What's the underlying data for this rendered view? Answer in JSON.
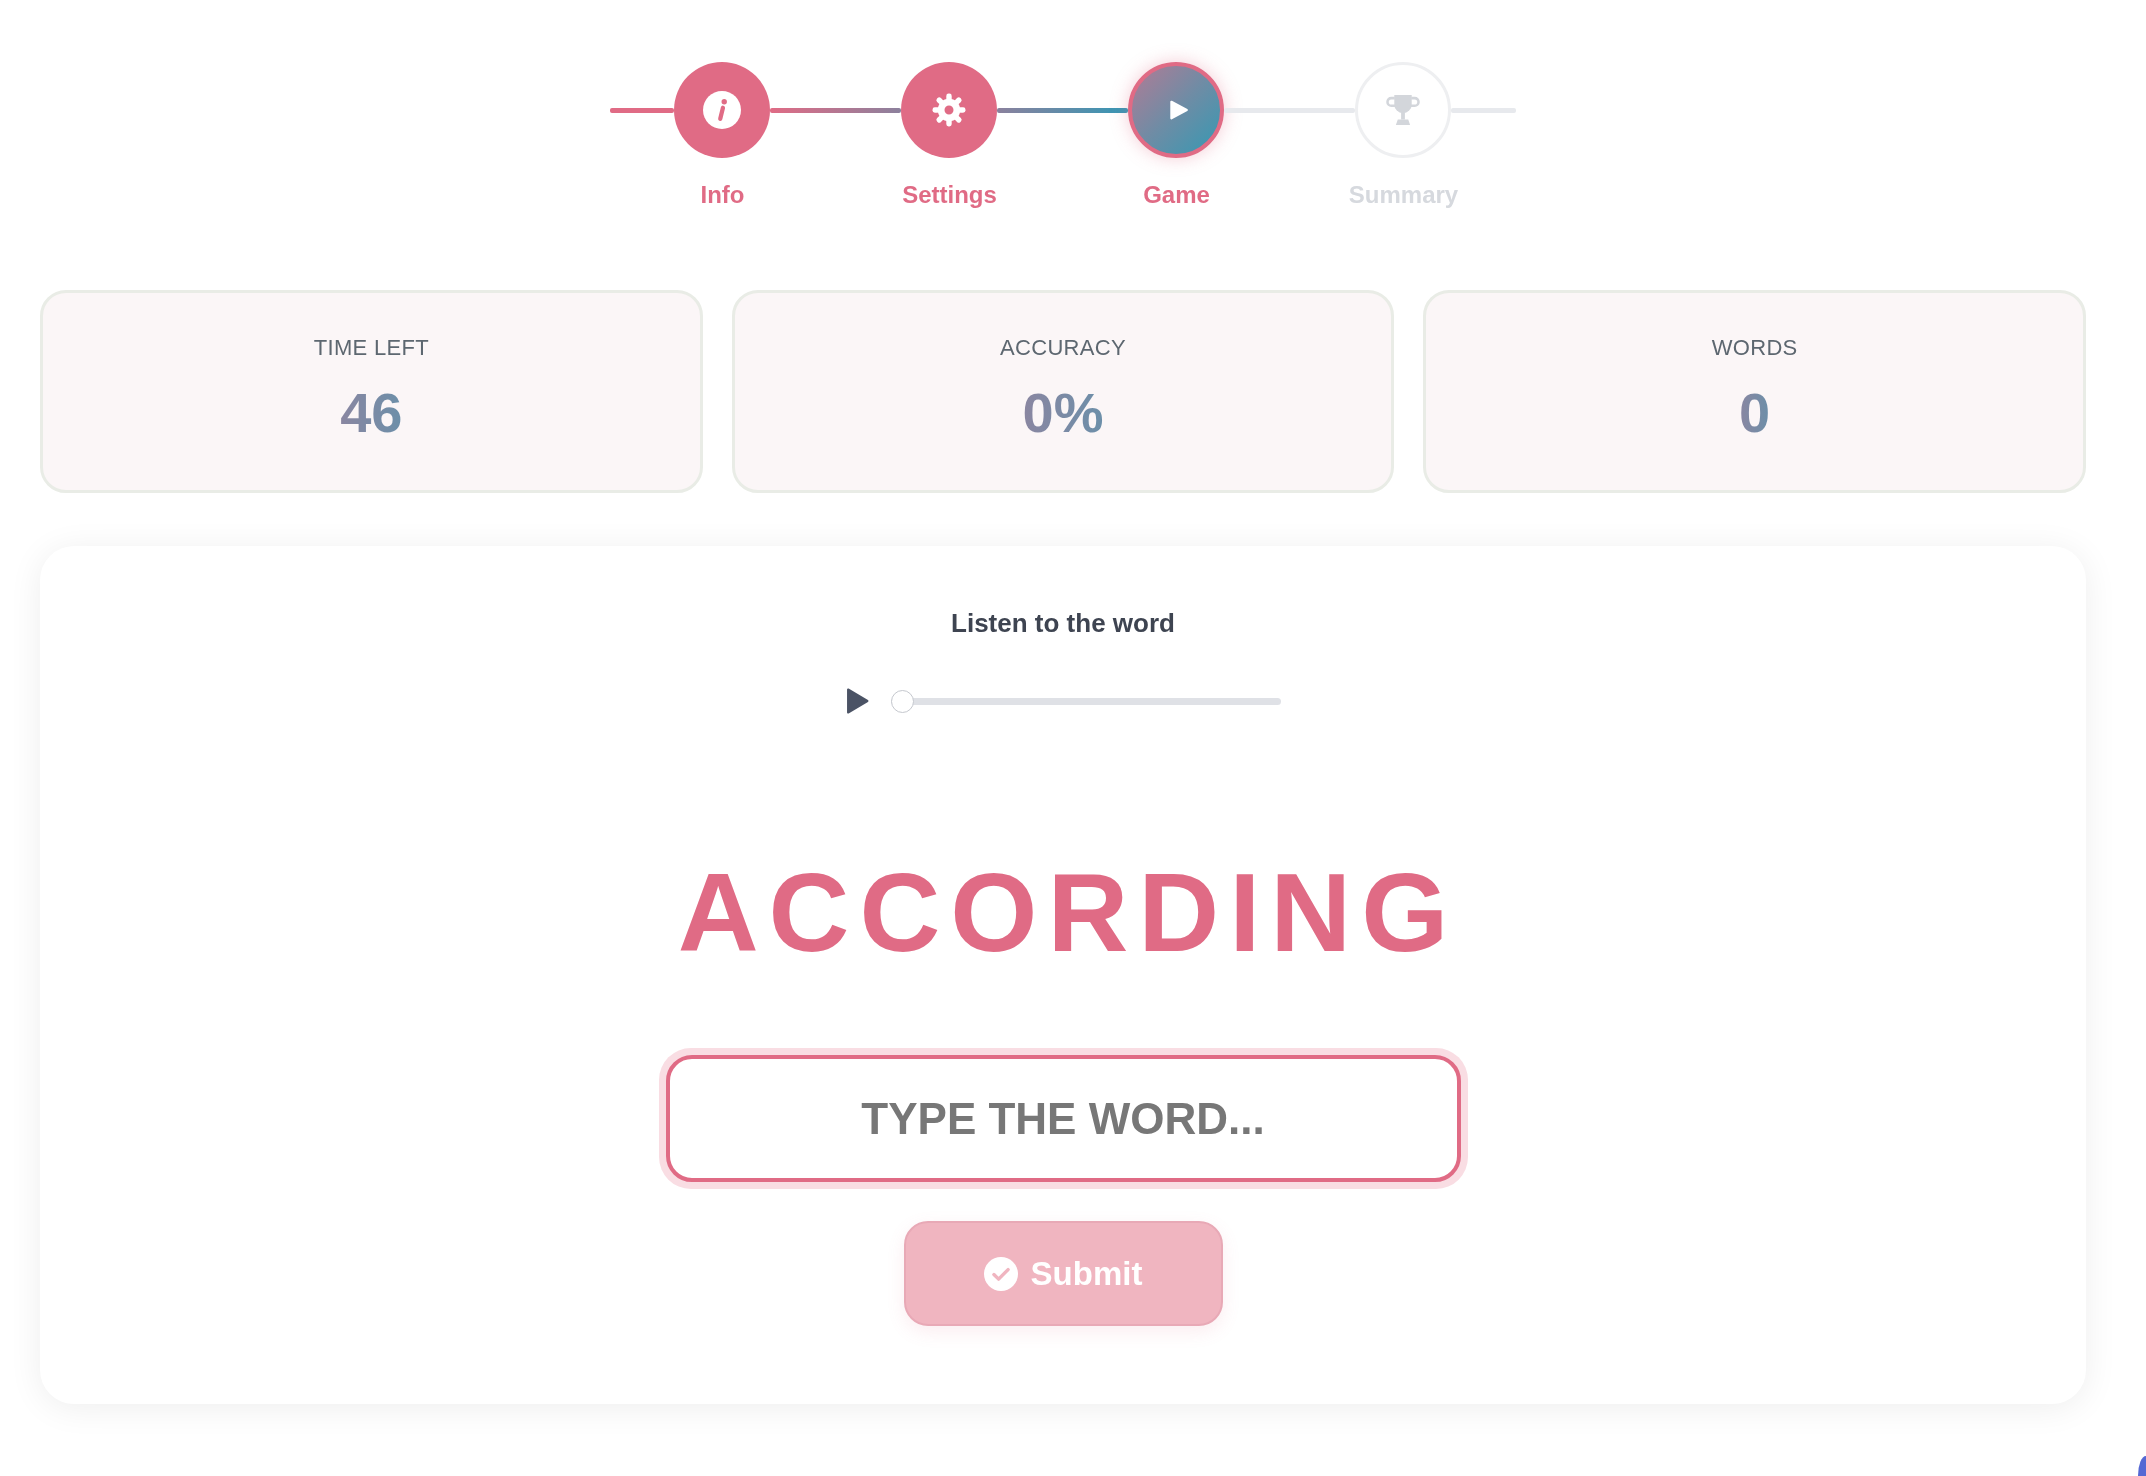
{
  "stepper": {
    "steps": [
      {
        "label": "Info",
        "completed": true,
        "selected": false
      },
      {
        "label": "Settings",
        "completed": true,
        "selected": false
      },
      {
        "label": "Game",
        "completed": false,
        "selected": true
      },
      {
        "label": "Summary",
        "completed": false,
        "selected": false
      }
    ]
  },
  "stats": [
    {
      "label": "TIME LEFT",
      "value": "46"
    },
    {
      "label": "ACCURACY",
      "value": "0%"
    },
    {
      "label": "WORDS",
      "value": "0"
    }
  ],
  "game": {
    "prompt": "Listen to the word",
    "audio": {
      "playing": false,
      "level": 0
    },
    "word": "ACCORDING",
    "answer": {
      "placeholder": "TYPE THE WORD..."
    },
    "submit": {
      "label": "Submit",
      "disabled": true
    }
  }
}
